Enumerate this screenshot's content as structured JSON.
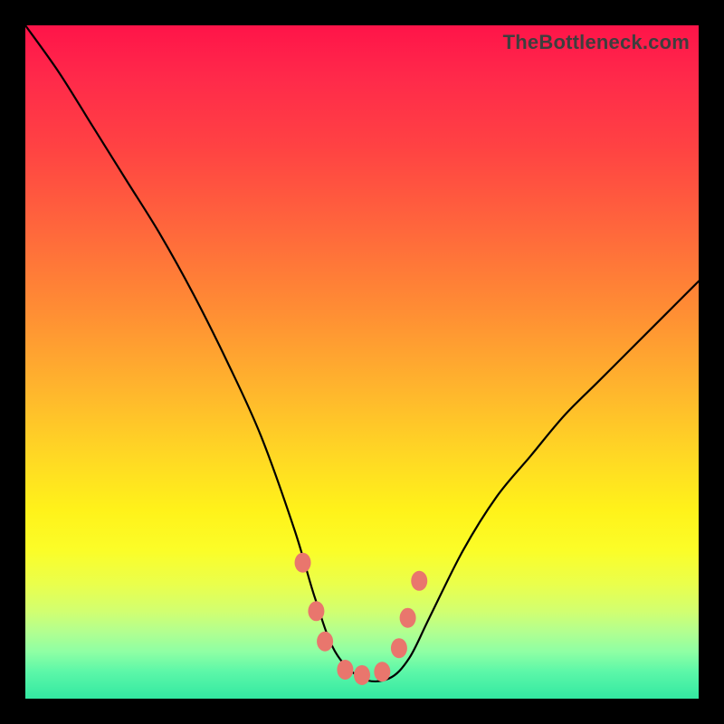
{
  "watermark": "TheBottleneck.com",
  "chart_data": {
    "type": "line",
    "title": "",
    "xlabel": "",
    "ylabel": "",
    "xlim": [
      0,
      1
    ],
    "ylim": [
      0,
      1
    ],
    "series": [
      {
        "name": "bottleneck-curve",
        "x": [
          0.0,
          0.05,
          0.1,
          0.15,
          0.2,
          0.25,
          0.3,
          0.35,
          0.4,
          0.43,
          0.46,
          0.5,
          0.54,
          0.57,
          0.6,
          0.65,
          0.7,
          0.75,
          0.8,
          0.85,
          0.9,
          0.95,
          1.0
        ],
        "values": [
          1.0,
          0.93,
          0.85,
          0.77,
          0.69,
          0.6,
          0.5,
          0.39,
          0.25,
          0.15,
          0.07,
          0.03,
          0.03,
          0.06,
          0.12,
          0.22,
          0.3,
          0.36,
          0.42,
          0.47,
          0.52,
          0.57,
          0.62
        ]
      }
    ],
    "markers": {
      "name": "highlight-points",
      "color": "#e9766d",
      "x": [
        0.412,
        0.432,
        0.445,
        0.475,
        0.5,
        0.53,
        0.555,
        0.568,
        0.585
      ],
      "values": [
        0.202,
        0.13,
        0.085,
        0.043,
        0.035,
        0.04,
        0.075,
        0.12,
        0.175
      ]
    },
    "annotations": []
  }
}
